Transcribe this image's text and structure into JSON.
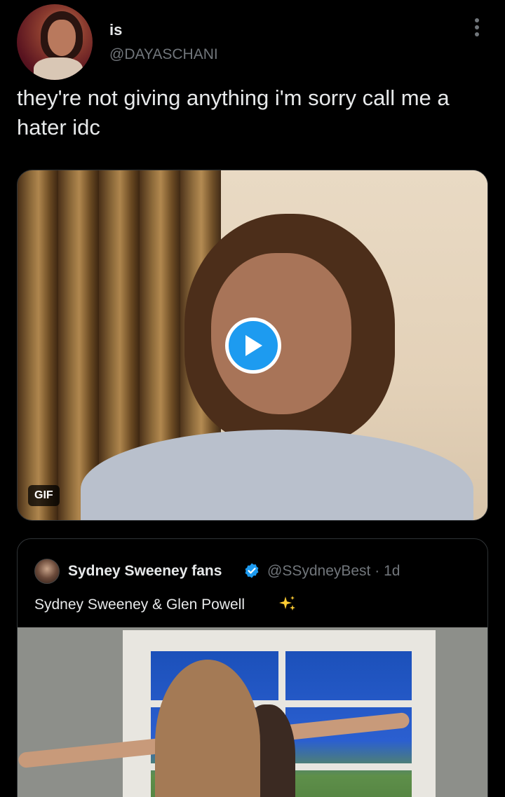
{
  "tweet": {
    "display_name": "is",
    "handle": "@DAYASCHANI",
    "text": "they're not giving anything i'm sorry call me a hater idc",
    "media": {
      "badge": "GIF",
      "play_icon": "play-icon"
    }
  },
  "quote": {
    "author_name": "Sydney Sweeney fans",
    "verified_icon": "verified-badge-icon",
    "handle": "@SSydneyBest",
    "separator": "·",
    "time": "1d",
    "text": "Sydney Sweeney & Glen Powell",
    "emoji_icon": "sparkles-icon"
  },
  "colors": {
    "background": "#000000",
    "text_primary": "#e7e9ea",
    "text_secondary": "#71767b",
    "accent": "#1d9bf0",
    "border": "#2f3336"
  }
}
